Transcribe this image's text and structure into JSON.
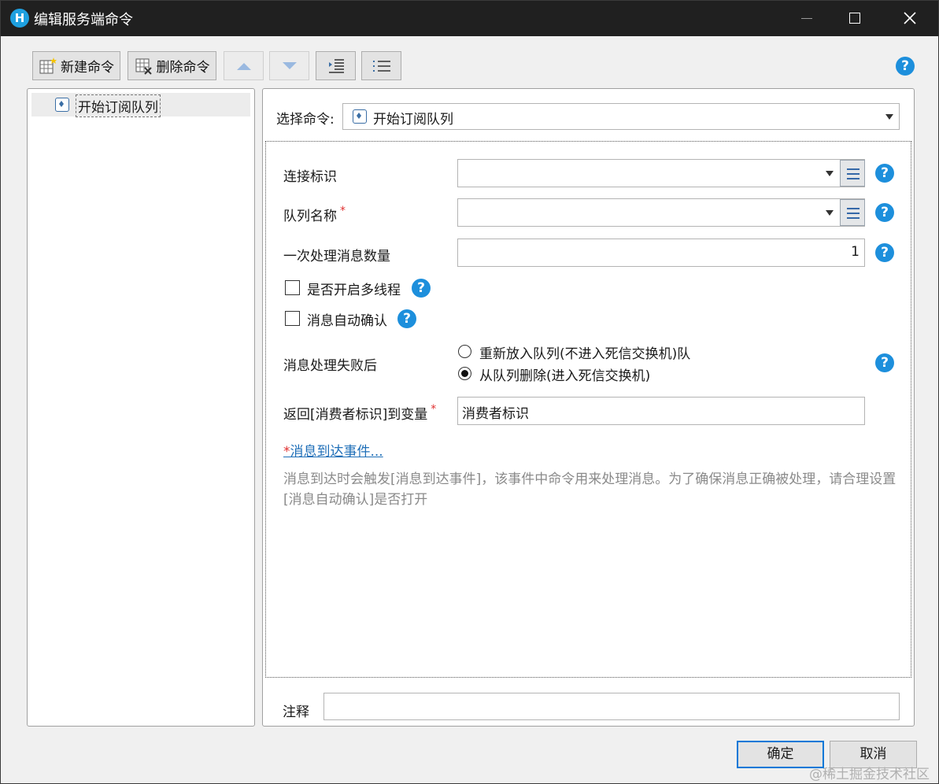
{
  "window": {
    "title": "编辑服务端命令",
    "app_icon_letter": "H"
  },
  "toolbar": {
    "new_command": "新建命令",
    "delete_command": "删除命令"
  },
  "tree": {
    "items": [
      {
        "label": "开始订阅队列"
      }
    ]
  },
  "command": {
    "select_label": "选择命令:",
    "selected_value": "开始订阅队列"
  },
  "form": {
    "connection_id_label": "连接标识",
    "connection_id_value": "",
    "queue_name_label": "队列名称",
    "queue_name_value": "",
    "batch_count_label": "一次处理消息数量",
    "batch_count_value": "1",
    "multithread_label": "是否开启多线程",
    "multithread_checked": false,
    "auto_ack_label": "消息自动确认",
    "auto_ack_checked": false,
    "on_failure_label": "消息处理失败后",
    "on_failure_options": [
      "重新放入队列(不进入死信交换机)队",
      "从队列删除(进入死信交换机)"
    ],
    "on_failure_selected_index": 1,
    "return_var_label": "返回[消费者标识]到变量",
    "return_var_value": "消费者标识",
    "required_mark": "*",
    "event_link": "消息到达事件...",
    "description": "消息到达时会触发[消息到达事件]，该事件中命令用来处理消息。为了确保消息正确被处理，请合理设置[消息自动确认]是否打开",
    "note_label": "注释",
    "note_value": ""
  },
  "footer": {
    "ok": "确定",
    "cancel": "取消"
  },
  "watermark": "@稀土掘金技术社区",
  "colors": {
    "titlebar": "#202020",
    "help_icon": "#1d8fdc",
    "required": "#e03030",
    "link": "#1f6fb8",
    "accent_border": "#0078d7"
  }
}
